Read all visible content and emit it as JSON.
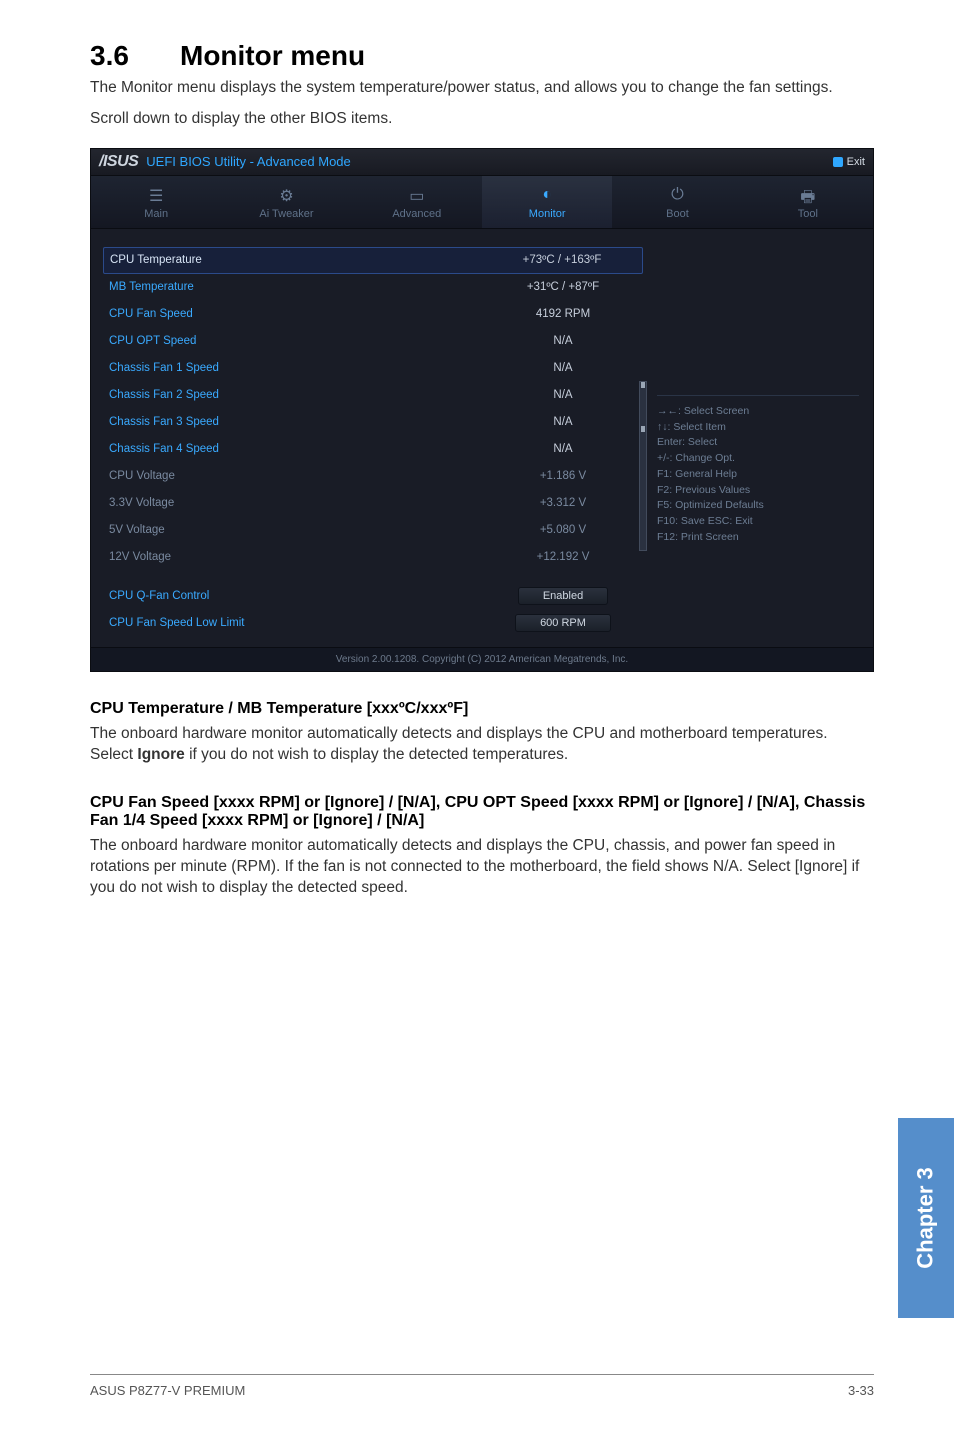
{
  "section": {
    "number": "3.6",
    "title": "Monitor menu",
    "intro1": "The Monitor menu displays the system temperature/power status, and allows you to change the fan settings.",
    "intro2": "Scroll down to display the other BIOS items."
  },
  "bios": {
    "brand": "/ISUS",
    "title": "UEFI BIOS Utility - Advanced Mode",
    "exit": "Exit",
    "tabs": [
      {
        "label": "Main",
        "icon": "☰"
      },
      {
        "label": "Ai Tweaker",
        "icon": "⚙"
      },
      {
        "label": "Advanced",
        "icon": "▭"
      },
      {
        "label": "Monitor",
        "icon": "◐"
      },
      {
        "label": "Boot",
        "icon": "⏻"
      },
      {
        "label": "Tool",
        "icon": "🖶"
      }
    ],
    "active_tab": 3,
    "rows": [
      {
        "label": "CPU Temperature",
        "value": "+73ºC / +163ºF",
        "selected": true
      },
      {
        "label": "MB Temperature",
        "value": "+31ºC / +87ºF"
      },
      {
        "label": "CPU Fan Speed",
        "value": "4192 RPM"
      },
      {
        "label": "CPU OPT Speed",
        "value": "N/A"
      },
      {
        "label": "Chassis Fan 1 Speed",
        "value": "N/A"
      },
      {
        "label": "Chassis Fan 2 Speed",
        "value": "N/A"
      },
      {
        "label": "Chassis Fan 3 Speed",
        "value": "N/A"
      },
      {
        "label": "Chassis Fan 4 Speed",
        "value": "N/A"
      },
      {
        "label": "CPU Voltage",
        "value": "+1.186 V",
        "dim": true
      },
      {
        "label": "3.3V Voltage",
        "value": "+3.312 V",
        "dim": true
      },
      {
        "label": "5V Voltage",
        "value": "+5.080 V",
        "dim": true
      },
      {
        "label": "12V Voltage",
        "value": "+12.192 V",
        "dim": true
      }
    ],
    "extra_rows": [
      {
        "label": "CPU Q-Fan Control",
        "value": "Enabled",
        "pill": true
      },
      {
        "label": "CPU Fan Speed Low Limit",
        "value": "600 RPM",
        "pill": true
      }
    ],
    "help": [
      "→←: Select Screen",
      "↑↓: Select Item",
      "Enter: Select",
      "+/-: Change Opt.",
      "F1: General Help",
      "F2: Previous Values",
      "F5: Optimized Defaults",
      "F10: Save   ESC: Exit",
      "F12: Print Screen"
    ],
    "footer": "Version 2.00.1208. Copyright (C) 2012 American Megatrends, Inc."
  },
  "subsection1": {
    "title": "CPU Temperature / MB Temperature [xxxºC/xxxºF]",
    "body_a": "The onboard hardware monitor automatically detects and displays the CPU and motherboard temperatures. Select ",
    "body_bold": "Ignore",
    "body_b": " if you do not wish to display the detected temperatures."
  },
  "subsection2": {
    "title": "CPU Fan Speed [xxxx RPM] or [Ignore] / [N/A], CPU OPT Speed [xxxx RPM] or [Ignore] / [N/A], Chassis Fan 1/4 Speed [xxxx RPM] or [Ignore] / [N/A]",
    "body": "The onboard hardware monitor automatically detects and displays the CPU, chassis, and power fan speed in rotations per minute (RPM). If the fan is not connected to the motherboard, the field shows N/A. Select [Ignore] if you do not wish to display the detected speed."
  },
  "chapter_tab": "Chapter 3",
  "footer": {
    "left": "ASUS P8Z77-V PREMIUM",
    "right": "3-33"
  }
}
